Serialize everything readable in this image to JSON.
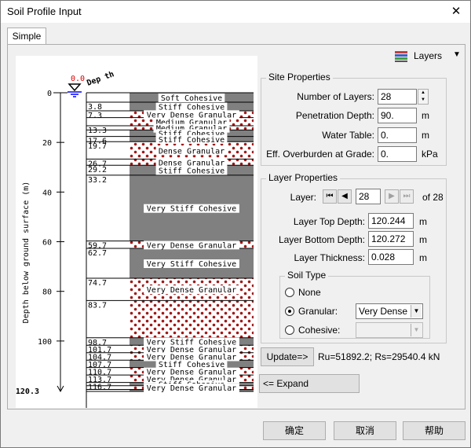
{
  "window": {
    "title": "Soil Profile Input",
    "close_glyph": "✕"
  },
  "tab": {
    "label": "Simple"
  },
  "layers_button": {
    "label": "Layers",
    "arrow": "▼"
  },
  "site": {
    "title": "Site Properties",
    "num_layers_label": "Number of Layers:",
    "num_layers_value": "28",
    "pen_depth_label": "Penetration Depth:",
    "pen_depth_value": "90.",
    "pen_depth_unit": "m",
    "water_table_label": "Water Table:",
    "water_table_value": "0.",
    "water_table_unit": "m",
    "overburden_label": "Eff. Overburden at Grade:",
    "overburden_value": "0.",
    "overburden_unit": "kPa"
  },
  "layer": {
    "title": "Layer Properties",
    "layer_label": "Layer:",
    "layer_value": "28",
    "of_label": "of 28",
    "top_label": "Layer Top Depth:",
    "top_value": "120.244",
    "top_unit": "m",
    "bottom_label": "Layer Bottom Depth:",
    "bottom_value": "120.272",
    "bottom_unit": "m",
    "thick_label": "Layer Thickness:",
    "thick_value": "0.028",
    "thick_unit": "m",
    "soil_type": {
      "title": "Soil Type",
      "none": "None",
      "granular": "Granular:",
      "cohesive": "Cohesive:",
      "granular_value": "Very Dense",
      "cohesive_value": ""
    }
  },
  "update_button": "Update=>",
  "result_text": "Ru=51892.2; Rs=29540.4 kN",
  "expand_button": "<= Expand",
  "ok_button": "确定",
  "cancel_button": "取消",
  "help_button": "帮助",
  "profile": {
    "wt_value": "0.0",
    "depth_header": "Dep th",
    "yaxis_label": "Depth below ground surface (m)",
    "ticks": [
      "0",
      "20",
      "40",
      "60",
      "80",
      "100"
    ],
    "tick_values": [
      0,
      20,
      40,
      60,
      80,
      100
    ],
    "max_depth": 120.3,
    "max_label": "120.3",
    "layers": [
      {
        "top": "",
        "top_v": 0,
        "bot_v": 3.8,
        "type": "Soft Cohesive",
        "pat": "gray"
      },
      {
        "top": "3.8",
        "top_v": 3.8,
        "bot_v": 7.3,
        "type": "Stiff Cohesive",
        "pat": "gray"
      },
      {
        "top": "7.3",
        "top_v": 7.3,
        "bot_v": 10.0,
        "type": "Very Dense Granular",
        "pat": "dots"
      },
      {
        "top": "",
        "top_v": 10.0,
        "bot_v": 13.3,
        "type": "Medium Granular",
        "pat": "dots"
      },
      {
        "top": "13.3",
        "top_v": 13.3,
        "bot_v": 15.0,
        "type": "Medium Granular",
        "pat": "dots"
      },
      {
        "top": "",
        "top_v": 15.0,
        "bot_v": 17.6,
        "type": "Stiff Cohesive",
        "pat": "gray"
      },
      {
        "top": "17.6",
        "top_v": 17.6,
        "bot_v": 19.7,
        "type": "Stiff Cohesive",
        "pat": "gray"
      },
      {
        "top": "19.7",
        "top_v": 19.7,
        "bot_v": 26.7,
        "type": "Dense Granular",
        "pat": "dots"
      },
      {
        "top": "26.7",
        "top_v": 26.7,
        "bot_v": 29.2,
        "type": "Dense Granular",
        "pat": "dots"
      },
      {
        "top": "29.2",
        "top_v": 29.2,
        "bot_v": 33.2,
        "type": "Stiff Cohesive",
        "pat": "gray"
      },
      {
        "top": "33.2",
        "top_v": 33.2,
        "bot_v": 59.7,
        "type": "Very Stiff Cohesive",
        "pat": "gray"
      },
      {
        "top": "59.7",
        "top_v": 59.7,
        "bot_v": 62.7,
        "type": "Very Dense Granular",
        "pat": "dots"
      },
      {
        "top": "62.7",
        "top_v": 62.7,
        "bot_v": 74.7,
        "type": "Very Stiff Cohesive",
        "pat": "gray"
      },
      {
        "top": "74.7",
        "top_v": 74.7,
        "bot_v": 83.7,
        "type": "Very Dense Granular",
        "pat": "dots"
      },
      {
        "top": "83.7",
        "top_v": 83.7,
        "bot_v": 98.7,
        "type": "",
        "pat": "dots"
      },
      {
        "top": "98.7",
        "top_v": 98.7,
        "bot_v": 101.7,
        "type": "Very Stiff Cohesive",
        "pat": "gray"
      },
      {
        "top": "101.7",
        "top_v": 101.7,
        "bot_v": 104.7,
        "type": "Very Dense Granular",
        "pat": "dots"
      },
      {
        "top": "104.7",
        "top_v": 104.7,
        "bot_v": 107.7,
        "type": "Very Dense Granular",
        "pat": "dots"
      },
      {
        "top": "107.7",
        "top_v": 107.7,
        "bot_v": 110.7,
        "type": "Stiff Cohesive",
        "pat": "gray"
      },
      {
        "top": "110.7",
        "top_v": 110.7,
        "bot_v": 113.7,
        "type": "Very Dense Granular",
        "pat": "dots"
      },
      {
        "top": "113.7",
        "top_v": 113.7,
        "bot_v": 116.7,
        "type": "Very Dense Granular",
        "pat": "dots"
      },
      {
        "top": "116.7",
        "top_v": 116.7,
        "bot_v": 118.0,
        "type": "Stiff Cohesive",
        "pat": "gray"
      },
      {
        "top": "",
        "top_v": 118.0,
        "bot_v": 119.5,
        "type": "Very Dense Granular",
        "pat": "dots"
      },
      {
        "top": "",
        "top_v": 119.5,
        "bot_v": 120.3,
        "type": "",
        "pat": "gray"
      }
    ]
  }
}
